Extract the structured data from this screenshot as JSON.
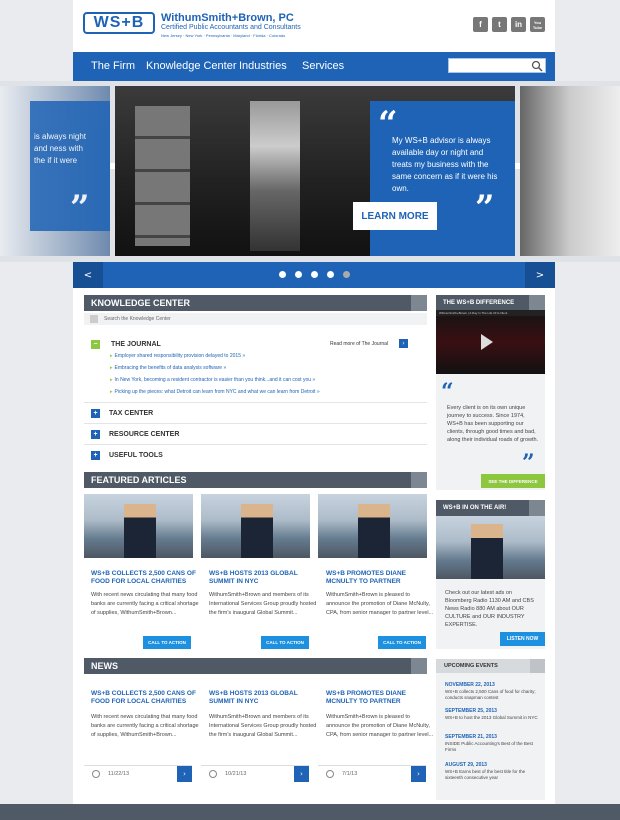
{
  "header": {
    "logo_mark": "WS+B",
    "firm_name": "WithumSmith+Brown, PC",
    "firm_sub": "Certified Public Accountants and Consultants",
    "locations": "New Jersey · New York · Pennsylvania · Maryland · Florida · Colorado",
    "social": [
      "f",
      "t",
      "in",
      "You Tube"
    ]
  },
  "nav": {
    "items": [
      "The Firm",
      "Knowledge Center",
      "Industries",
      "Services"
    ],
    "search_placeholder": ""
  },
  "hero": {
    "quote": "My WS+B advisor is always available day or night and treats my business with the same concern as if it were his own.",
    "left_quote": "is always night and ness with the if it were",
    "button": "LEARN MORE"
  },
  "carousel": {
    "prev": "<",
    "next": ">"
  },
  "knowledge": {
    "title": "KNOWLEDGE CENTER",
    "search_placeholder": "Search the Knowledge Center",
    "journal_title": "THE JOURNAL",
    "journal_more": "Read more of The Journal",
    "links": [
      "Employer shared responsibility provision delayed to 2015 »",
      "Embracing the benefits of data analysis software »",
      "In New York, becoming a resident contractor is easier than you think...and it can cost you »",
      "Picking up the pieces: what Detroit can learn from NYC and what we can learn from Detroit »"
    ],
    "items": [
      "TAX CENTER",
      "RESOURCE CENTER",
      "USEFUL TOOLS"
    ]
  },
  "featured": {
    "title": "FEATURED ARTICLES",
    "cta": "CALL TO ACTION",
    "cards": [
      {
        "title": "WS+B COLLECTS 2,500 CANS OF FOOD FOR LOCAL CHARITIES",
        "body": "With recent news circulating that many food banks are currently facing a critical shortage of supplies, WithumSmith+Brown..."
      },
      {
        "title": "WS+B HOSTS 2013 GLOBAL SUMMIT IN NYC",
        "body": "WithumSmith+Brown and members of its International Services Group proudly hosted the firm's inaugural Global Summit..."
      },
      {
        "title": "WS+B PROMOTES DIANE MCNULTY TO PARTNER",
        "body": "WithumSmith+Brown is pleased to announce the promotion of Diane McNulty, CPA, from senior manager to partner level..."
      }
    ]
  },
  "news": {
    "title": "NEWS",
    "items": [
      {
        "title": "WS+B COLLECTS 2,500 CANS OF FOOD FOR LOCAL CHARITIES",
        "body": "With recent news circulating that many food banks are currently facing a critical shortage of supplies, WithumSmith+Brown...",
        "date": "11/22/13"
      },
      {
        "title": "WS+B HOSTS 2013 GLOBAL SUMMIT IN NYC",
        "body": "WithumSmith+Brown and members of its International Services Group proudly hosted the firm's inaugural Global Summit...",
        "date": "10/21/13"
      },
      {
        "title": "WS+B PROMOTES DIANE MCNULTY TO PARTNER",
        "body": "WithumSmith+Brown is pleased to announce the promotion of Diane McNulty, CPA, from senior manager to partner level...",
        "date": "7/1/13"
      }
    ]
  },
  "sidebar": {
    "difference_title": "THE WS+B DIFFERENCE",
    "video_caption": "WithumSmith+Brown | A Day In The Life Of A Client",
    "difference_text": "Every client is on its own unique journey to success. Since 1974, WS+B has been supporting our clients, through good times and bad, along their individual roads of growth.",
    "difference_button": "SEE THE DIFFERENCE",
    "air_title": "WS+B IN ON THE AIR!",
    "air_text": "Check out our latest ads on Bloomberg Radio 1130 AM and CBS News Radio 880 AM about OUR CULTURE and OUR INDUSTRY EXPERTISE.",
    "listen": "LISTEN NOW",
    "events_title": "UPCOMING EVENTS",
    "events": [
      {
        "date": "NOVEMBER 22, 2013",
        "text": "WS+B collects 2,500 Cans of food for charity; conducts snapman contest"
      },
      {
        "date": "SEPTEMBER 25, 2013",
        "text": "WS+B to host the 2013 Global Summit in NYC"
      },
      {
        "date": "SEPTEMBER 21, 2013",
        "text": "INSIDE Public Accounting's Best of the Best Firms"
      },
      {
        "date": "AUGUST 29, 2013",
        "text": "WS+B Earns best of the best title for the sixteenth consecutive year"
      }
    ]
  }
}
